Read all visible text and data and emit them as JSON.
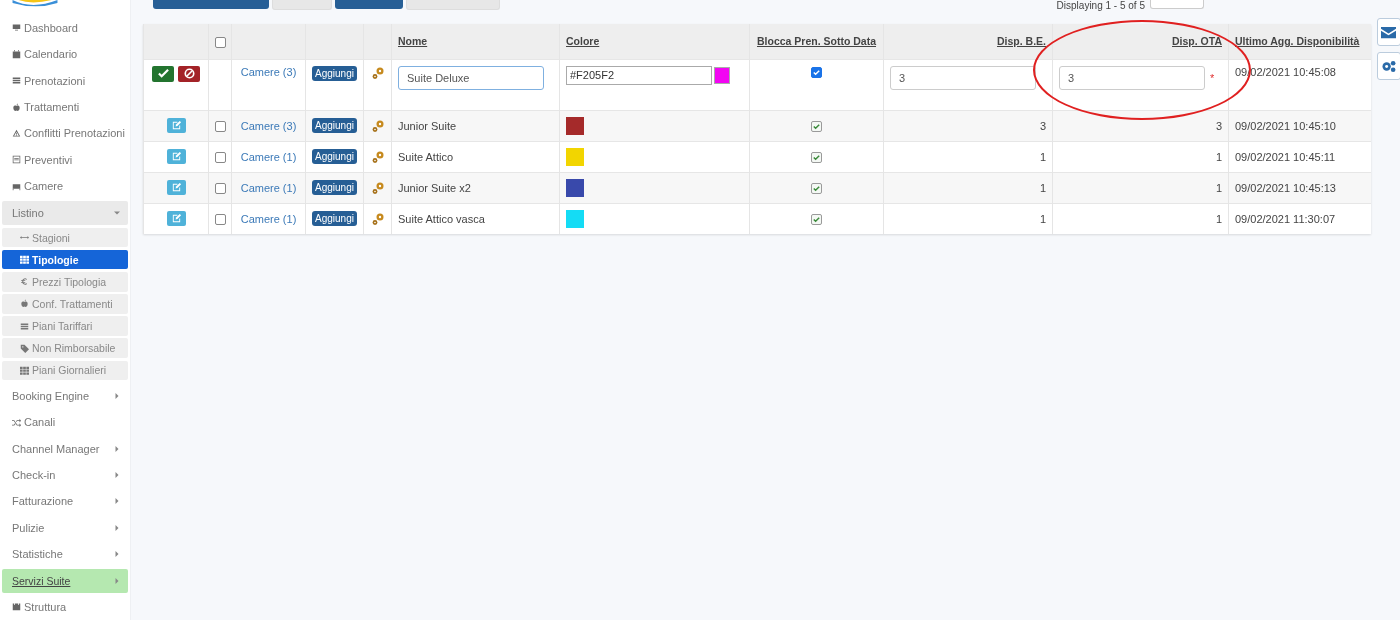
{
  "sidebar": {
    "items": [
      {
        "label": "Dashboard",
        "kind": "link",
        "highlighted": false
      },
      {
        "label": "Calendario",
        "kind": "link",
        "highlighted": false
      },
      {
        "label": "Prenotazioni",
        "kind": "link",
        "highlighted": false
      },
      {
        "label": "Trattamenti",
        "kind": "link",
        "highlighted": false
      },
      {
        "label": "Conflitti Prenotazioni",
        "kind": "link",
        "highlighted": false
      },
      {
        "label": "Preventivi",
        "kind": "link",
        "highlighted": false
      },
      {
        "label": "Camere",
        "kind": "link",
        "highlighted": false
      },
      {
        "label": "Listino",
        "kind": "group",
        "highlighted": false,
        "expanded": true,
        "children": [
          {
            "label": "Stagioni",
            "selected": false
          },
          {
            "label": "Tipologie",
            "selected": true
          },
          {
            "label": "Prezzi Tipologia",
            "selected": false
          },
          {
            "label": "Conf. Trattamenti",
            "selected": false
          },
          {
            "label": "Piani Tariffari",
            "selected": false
          },
          {
            "label": "Non Rimborsabile",
            "selected": false
          },
          {
            "label": "Piani Giornalieri",
            "selected": false
          }
        ]
      },
      {
        "label": "Booking Engine",
        "kind": "group",
        "highlighted": false,
        "expanded": false
      },
      {
        "label": "Canali",
        "kind": "link",
        "highlighted": false
      },
      {
        "label": "Channel Manager",
        "kind": "group",
        "highlighted": false,
        "expanded": false
      },
      {
        "label": "Check-in",
        "kind": "group",
        "highlighted": false,
        "expanded": false
      },
      {
        "label": "Fatturazione",
        "kind": "group",
        "highlighted": false,
        "expanded": false
      },
      {
        "label": "Pulizie",
        "kind": "group",
        "highlighted": false,
        "expanded": false
      },
      {
        "label": "Statistiche",
        "kind": "group",
        "highlighted": false,
        "expanded": false
      },
      {
        "label": "Servizi Suite",
        "kind": "group",
        "highlighted": true,
        "expanded": false
      },
      {
        "label": "Struttura",
        "kind": "link",
        "highlighted": false
      }
    ]
  },
  "pager": {
    "text": "Displaying 1 - 5 of 5"
  },
  "table": {
    "header_checkbox": {
      "checked": false
    },
    "columns": [
      {
        "label": "Nome",
        "circled": false
      },
      {
        "label": "Colore",
        "circled": false
      },
      {
        "label": "Blocca Pren. Sotto Data",
        "circled": false
      },
      {
        "label": "Disp. B.E.",
        "circled": false
      },
      {
        "label": "Disp. OTA",
        "circled": true
      },
      {
        "label": "Ultimo Agg. Disponibilità",
        "circled": false
      }
    ],
    "rows": [
      {
        "kind": "edit",
        "camere": "Camere (3)",
        "add": "Aggiungi",
        "nome": "Suite Deluxe",
        "colore": "#F205F2",
        "color": "#f205f2",
        "blocca": true,
        "disp_be": "3",
        "disp_ota": "3",
        "required": "*",
        "updated": "09/02/2021 10:45:08"
      },
      {
        "kind": "view",
        "selected": false,
        "camere": "Camere (3)",
        "add": "Aggiungi",
        "nome": "Junior Suite",
        "color": "#a52a2a",
        "blocca": true,
        "disp_be": "3",
        "disp_ota": "3",
        "updated": "09/02/2021 10:45:10"
      },
      {
        "kind": "view",
        "selected": false,
        "camere": "Camere (1)",
        "add": "Aggiungi",
        "nome": "Suite Attico",
        "color": "#f2d500",
        "blocca": true,
        "disp_be": "1",
        "disp_ota": "1",
        "updated": "09/02/2021 10:45:11"
      },
      {
        "kind": "view",
        "selected": false,
        "camere": "Camere (1)",
        "add": "Aggiungi",
        "nome": "Junior Suite x2",
        "color": "#3949ab",
        "blocca": true,
        "disp_be": "1",
        "disp_ota": "1",
        "updated": "09/02/2021 10:45:13"
      },
      {
        "kind": "view",
        "selected": false,
        "camere": "Camere (1)",
        "add": "Aggiungi",
        "nome": "Suite Attico vasca",
        "color": "#14dcf5",
        "blocca": true,
        "disp_be": "1",
        "disp_ota": "1",
        "updated": "09/02/2021 11:30:07"
      }
    ]
  }
}
